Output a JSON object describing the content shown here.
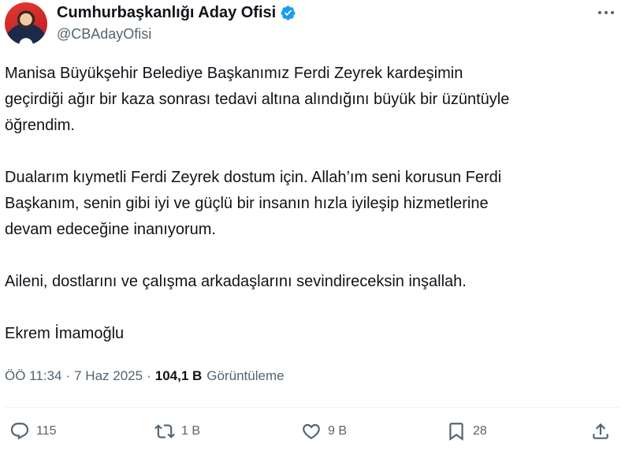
{
  "author": {
    "display_name": "Cumhurbaşkanlığı Aday Ofisi",
    "handle": "@CBAdayOfisi",
    "verified_color": "#1d9bf0"
  },
  "tweet": {
    "paragraphs": [
      [
        "Manisa Büyükşehir Belediye Başkanımız Ferdi Zeyrek kardeşimin",
        "geçirdiği ağır bir kaza sonrası tedavi altına alındığını büyük bir üzüntüyle",
        "öğrendim."
      ],
      [
        "Dualarım kıymetli Ferdi Zeyrek dostum için. Allah’ım seni korusun Ferdi",
        "Başkanım, senin  gibi iyi ve güçlü bir insanın hızla iyileşip hizmetlerine",
        "devam edeceğine inanıyorum."
      ],
      [
        "Aileni, dostlarını ve çalışma arkadaşlarını sevindireceksin inşallah."
      ],
      [
        "Ekrem İmamoğlu"
      ]
    ]
  },
  "meta": {
    "time": "ÖÖ 11:34",
    "separator": "·",
    "date": "7 Haz 2025",
    "views_count": "104,1 B",
    "views_label": "Görüntüleme"
  },
  "actions": {
    "reply": {
      "count": "115",
      "icon": "reply-icon"
    },
    "repost": {
      "count": "1 B",
      "icon": "repost-icon"
    },
    "like": {
      "count": "9 B",
      "icon": "heart-icon"
    },
    "bookmark": {
      "count": "28",
      "icon": "bookmark-icon"
    },
    "share": {
      "icon": "share-icon"
    }
  },
  "colors": {
    "text": "#0f1419",
    "secondary": "#536471",
    "verified": "#1d9bf0"
  }
}
